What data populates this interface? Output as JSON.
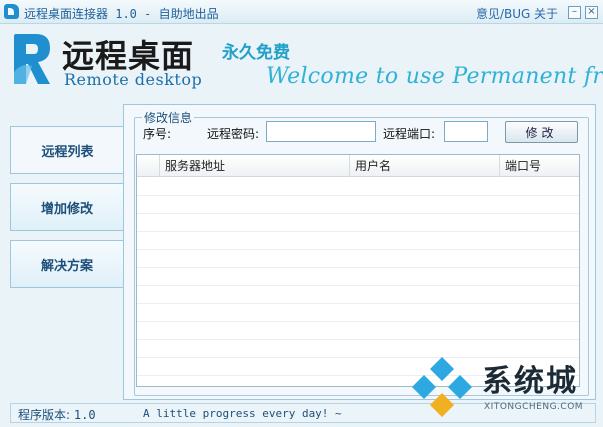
{
  "window": {
    "title": "远程桌面连接器 1.0 - 自助地出品",
    "feedback_label": "意见/BUG",
    "about_label": "关于",
    "minimize_glyph": "–",
    "close_glyph": "×"
  },
  "header": {
    "logo_cn": "远程桌面",
    "logo_en": "Remote desktop",
    "slogan_cn": "永久免费",
    "slogan_en": "Welcome to use  Permanent free"
  },
  "sidebar": {
    "items": [
      {
        "label": "远程列表",
        "active": true
      },
      {
        "label": "增加修改",
        "active": false
      },
      {
        "label": "解决方案",
        "active": false
      }
    ]
  },
  "edit_group": {
    "legend": "修改信息",
    "seq_label": "序号:",
    "password_label": "远程密码:",
    "password_value": "",
    "port_label": "远程端口:",
    "port_value": "",
    "edit_button": "修改"
  },
  "table": {
    "columns": [
      "",
      "服务器地址",
      "用户名",
      "端口号"
    ],
    "rows": []
  },
  "status": {
    "version_label": "程序版本:",
    "version_value": "1.0",
    "motto": "A little progress every day! ~"
  },
  "watermark": {
    "cn": "系统城",
    "en": "XITONGCHENG.COM"
  },
  "colors": {
    "accent": "#1f8fd0",
    "slogan": "#2fb2d6",
    "background": "#e9f3f8"
  }
}
